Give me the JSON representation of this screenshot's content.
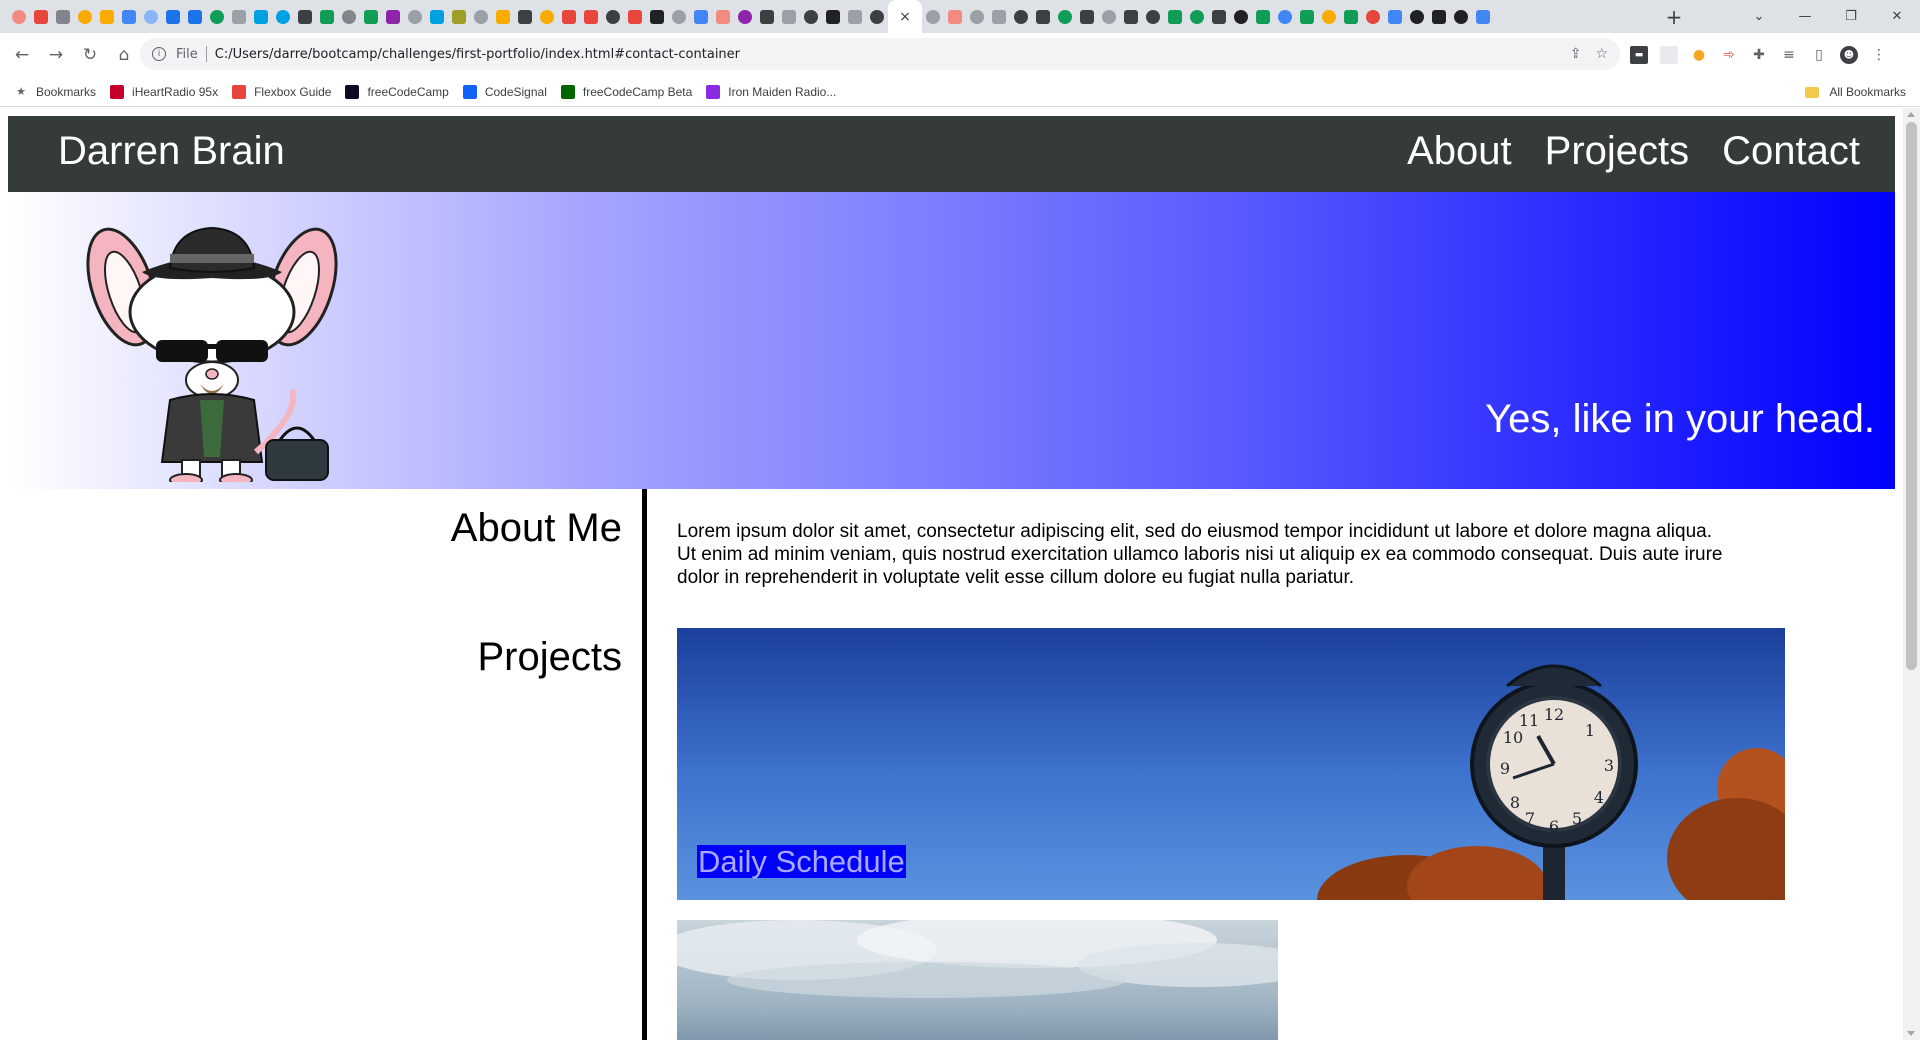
{
  "browser": {
    "url_scheme": "File",
    "url": "C:/Users/darre/bootcamp/challenges/first-portfolio/index.html#contact-container",
    "active_tab_close": "×",
    "new_tab": "+",
    "bookmarks": [
      {
        "label": "Bookmarks",
        "icon": "star-icon",
        "color": "#5f6368"
      },
      {
        "label": "iHeartRadio 95x",
        "icon": "iheartradio-icon",
        "color": "#c6002b"
      },
      {
        "label": "Flexbox Guide",
        "icon": "asterisk-icon",
        "color": "#e8453c"
      },
      {
        "label": "freeCodeCamp",
        "icon": "freecodecamp-icon",
        "color": "#0a0a23"
      },
      {
        "label": "CodeSignal",
        "icon": "codesignal-icon",
        "color": "#1062fb"
      },
      {
        "label": "freeCodeCamp Beta",
        "icon": "freecodecamp-beta-icon",
        "color": "#006400"
      },
      {
        "label": "Iron Maiden Radio...",
        "icon": "pandora-icon",
        "color": "#8a2be2"
      }
    ],
    "all_bookmarks": "All Bookmarks"
  },
  "site": {
    "title": "Darren Brain",
    "nav": [
      {
        "label": "About"
      },
      {
        "label": "Projects"
      },
      {
        "label": "Contact"
      }
    ],
    "tagline": "Yes, like in your head.",
    "about_heading": "About Me",
    "about_text": "Lorem ipsum dolor sit amet, consectetur adipiscing elit, sed do eiusmod tempor incididunt ut labore et dolore magna aliqua. Ut enim ad minim veniam, quis nostrud exercitation ullamco laboris nisi ut aliquip ex ea commodo consequat. Duis aute irure dolor in reprehenderit in voluptate velit esse cillum dolore eu fugiat nulla pariatur.",
    "projects_heading": "Projects",
    "projects": [
      {
        "label": "Daily Schedule"
      }
    ]
  },
  "colors": {
    "header_bg": "#353b3b",
    "hero_start": "#ffffff",
    "hero_end": "#0000ff",
    "label_bg": "#0000ff",
    "label_text": "#a9a9ff"
  }
}
